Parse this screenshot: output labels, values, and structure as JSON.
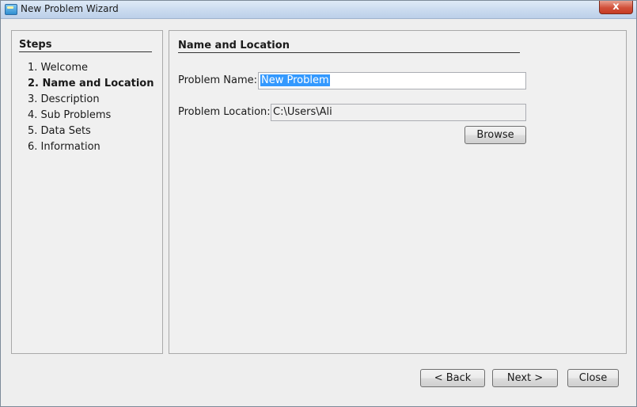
{
  "window": {
    "title": "New Problem Wizard",
    "close_glyph": "x"
  },
  "steps": {
    "title": "Steps",
    "items": [
      {
        "label": "1. Welcome",
        "current": false
      },
      {
        "label": "2. Name and Location",
        "current": true
      },
      {
        "label": "3. Description",
        "current": false
      },
      {
        "label": "4. Sub Problems",
        "current": false
      },
      {
        "label": "5. Data Sets",
        "current": false
      },
      {
        "label": "6. Information",
        "current": false
      }
    ]
  },
  "main": {
    "section_title": "Name and Location",
    "problem_name_label": "Problem Name:",
    "problem_name_value": "New Problem",
    "problem_location_label": "Problem Location:",
    "problem_location_value": "C:\\Users\\Ali",
    "browse_label": "Browse"
  },
  "footer": {
    "back_label": "< Back",
    "next_label": "Next >",
    "close_label": "Close"
  },
  "colors": {
    "selection": "#3399ff",
    "titlebar": "#c8d9ee",
    "close_button": "#d1503a"
  }
}
